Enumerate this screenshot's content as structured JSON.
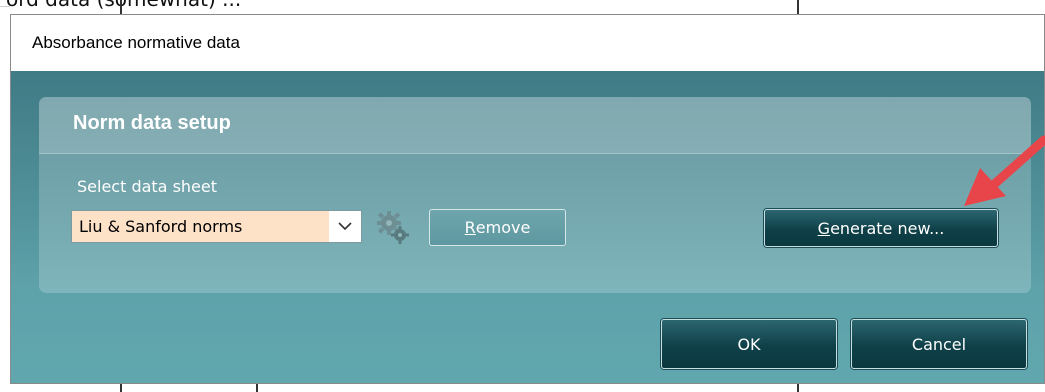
{
  "background": {
    "partial_text": "ord data (somewhat) ..."
  },
  "dialog": {
    "title": "Absorbance normative data",
    "group_title": "Norm data setup",
    "select_label": "Select data sheet",
    "data_sheet": {
      "selected_value": "Liu & Sanford norms",
      "arrow_icon": "chevron-down-icon"
    },
    "settings_icon": "gear-icon",
    "buttons": {
      "remove_mnemonic": "R",
      "remove_rest": "emove",
      "generate_mnemonic": "G",
      "generate_rest": "enerate new...",
      "ok": "OK",
      "cancel": "Cancel"
    }
  },
  "annotation": {
    "arrow_color": "#e8454a"
  },
  "colors": {
    "accent_teal": "#4e8d96",
    "button_dark": "#0f4048",
    "combo_highlight": "#fde2c8"
  }
}
